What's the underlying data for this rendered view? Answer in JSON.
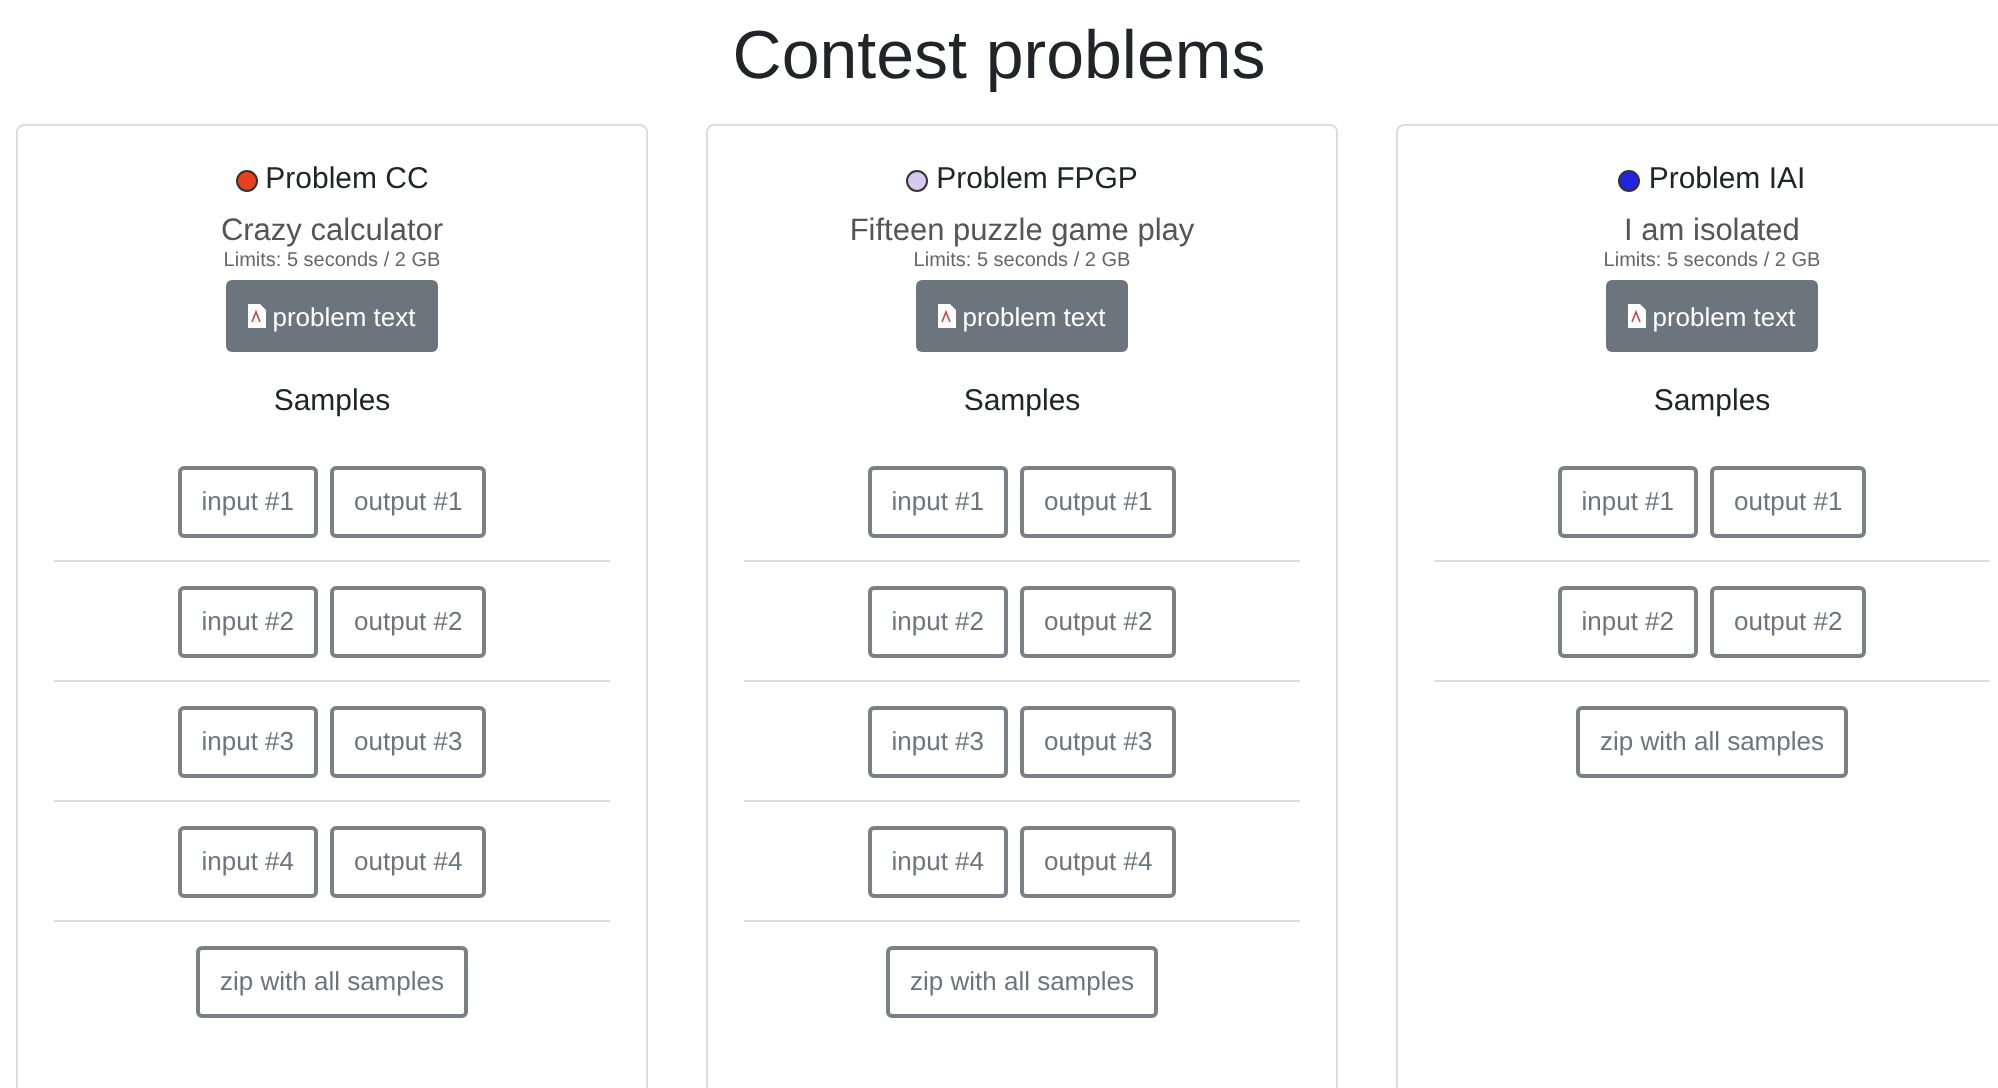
{
  "title": "Contest problems",
  "problems": [
    {
      "code": "Problem CC",
      "color": "#e8401c",
      "name": "Crazy calculator",
      "limits": "Limits: 5 seconds / 2 GB",
      "text_button": "problem text",
      "samples_heading": "Samples",
      "samples": [
        {
          "input": "input #1",
          "output": "output #1"
        },
        {
          "input": "input #2",
          "output": "output #2"
        },
        {
          "input": "input #3",
          "output": "output #3"
        },
        {
          "input": "input #4",
          "output": "output #4"
        }
      ],
      "zip": "zip with all samples"
    },
    {
      "code": "Problem FPGP",
      "color": "#d9c9ef",
      "name": "Fifteen puzzle game play",
      "limits": "Limits: 5 seconds / 2 GB",
      "text_button": "problem text",
      "samples_heading": "Samples",
      "samples": [
        {
          "input": "input #1",
          "output": "output #1"
        },
        {
          "input": "input #2",
          "output": "output #2"
        },
        {
          "input": "input #3",
          "output": "output #3"
        },
        {
          "input": "input #4",
          "output": "output #4"
        }
      ],
      "zip": "zip with all samples"
    },
    {
      "code": "Problem IAI",
      "color": "#2323e0",
      "name": "I am isolated",
      "limits": "Limits: 5 seconds / 2 GB",
      "text_button": "problem text",
      "samples_heading": "Samples",
      "samples": [
        {
          "input": "input #1",
          "output": "output #1"
        },
        {
          "input": "input #2",
          "output": "output #2"
        }
      ],
      "zip": "zip with all samples"
    }
  ]
}
